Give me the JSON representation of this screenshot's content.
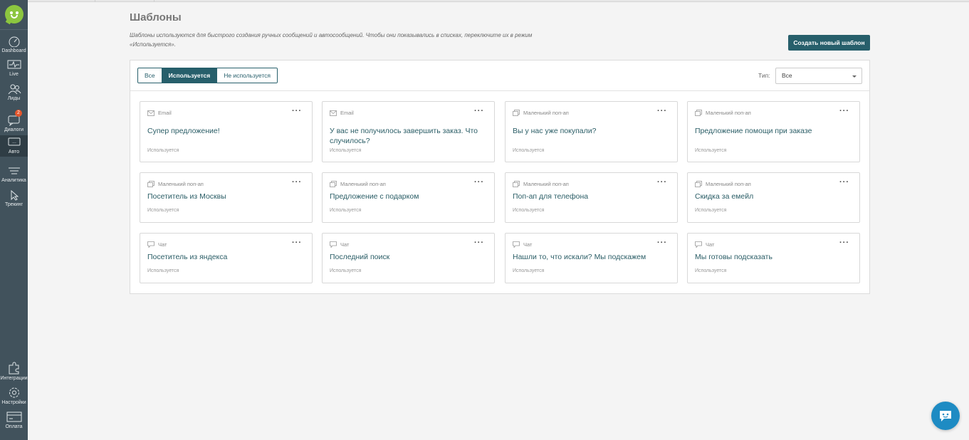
{
  "sidebar": {
    "items": [
      {
        "label": "Dashboard",
        "icon": "gauge-icon"
      },
      {
        "label": "Live",
        "icon": "pulse-icon"
      },
      {
        "label": "Лиды",
        "icon": "users-icon"
      },
      {
        "label": "Диалоги",
        "icon": "chat-icon",
        "badge": "2"
      },
      {
        "label": "Авто",
        "icon": "auto-message-icon"
      },
      {
        "label": "Аналитика",
        "icon": "funnel-icon"
      },
      {
        "label": "Трекинг",
        "icon": "cursor-icon"
      }
    ],
    "bottom_items": [
      {
        "label": "Интеграции",
        "icon": "puzzle-icon"
      },
      {
        "label": "Настройки",
        "icon": "gear-icon"
      },
      {
        "label": "Оплата",
        "icon": "card-icon"
      }
    ]
  },
  "header": {
    "title": "Шаблоны",
    "description": "Шаблоны используются для быстрого создания ручных сообщений и автосообщений. Чтобы они показывались в списках, переключите их в режим «Используется».",
    "create_button": "Создать новый шаблон"
  },
  "filters": {
    "tabs": [
      {
        "label": "Все",
        "active": false
      },
      {
        "label": "Используется",
        "active": true
      },
      {
        "label": "Не используется",
        "active": false
      }
    ],
    "type_label": "Тип:",
    "type_value": "Все"
  },
  "cards": [
    {
      "type": "Email",
      "icon": "envelope-icon",
      "title": "Супер предложение!",
      "status": "Используется"
    },
    {
      "type": "Email",
      "icon": "envelope-icon",
      "title": "У вас не получилось завершить заказ. Что случилось?",
      "status": "Используется"
    },
    {
      "type": "Маленький поп-ап",
      "icon": "popup-icon",
      "title": "Вы у нас уже покупали?",
      "status": "Используется"
    },
    {
      "type": "Маленький поп-ап",
      "icon": "popup-icon",
      "title": "Предложение помощи при заказе",
      "status": "Используется"
    },
    {
      "type": "Маленький поп-ап",
      "icon": "popup-icon",
      "title": "Посетитель из Москвы",
      "status": "Используется"
    },
    {
      "type": "Маленький поп-ап",
      "icon": "popup-icon",
      "title": "Предложение с подарком",
      "status": "Используется"
    },
    {
      "type": "Маленький поп-ап",
      "icon": "popup-icon",
      "title": "Поп-ап для телефона",
      "status": "Используется"
    },
    {
      "type": "Маленький поп-ап",
      "icon": "popup-icon",
      "title": "Скидка за емейл",
      "status": "Используется"
    },
    {
      "type": "Чат",
      "icon": "chat-bubble-icon",
      "title": "Посетитель из яндекса",
      "status": "Используется"
    },
    {
      "type": "Чат",
      "icon": "chat-bubble-icon",
      "title": "Последний поиск",
      "status": "Используется"
    },
    {
      "type": "Чат",
      "icon": "chat-bubble-icon",
      "title": "Нашли то, что искали? Мы подскажем",
      "status": "Используется"
    },
    {
      "type": "Чат",
      "icon": "chat-bubble-icon",
      "title": "Мы готовы подсказать",
      "status": "Используется"
    }
  ],
  "more_label": "···",
  "colors": {
    "sidebar": "#41525c",
    "accent": "#275f6b",
    "logo": "#8cc63f",
    "badge": "#e5562c",
    "chat_widget": "#1e8bc3"
  }
}
